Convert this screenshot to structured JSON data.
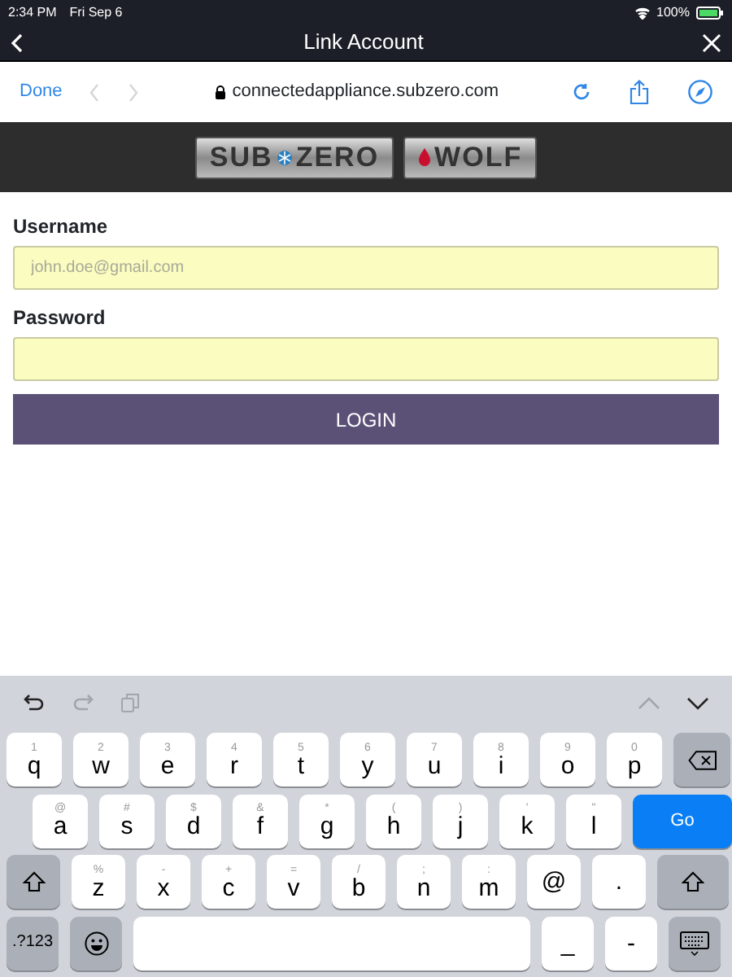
{
  "status_bar": {
    "time": "2:34 PM",
    "date": "Fri Sep 6",
    "battery": "100%"
  },
  "nav_bar": {
    "title": "Link Account"
  },
  "browser_bar": {
    "done": "Done",
    "back_disabled": true,
    "forward_disabled": true,
    "url": "connectedappliance.subzero.com"
  },
  "logos": {
    "subzero": [
      "SUB",
      "ZERO"
    ],
    "wolf": "WOLF"
  },
  "form": {
    "fields": [
      {
        "label": "Username",
        "placeholder": "john.doe@gmail.com"
      },
      {
        "label": "Password"
      }
    ],
    "button": "LOGIN"
  },
  "keyboard": {
    "toolbar": [
      {
        "kind": "undo",
        "disabled": false
      },
      {
        "kind": "redo",
        "disabled": true
      },
      {
        "kind": "paste",
        "disabled": true
      }
    ],
    "up_disabled": true,
    "down_disabled": false,
    "rows": [
      [
        {
          "kind": "letter",
          "label": "q",
          "hint": "1"
        },
        {
          "kind": "letter",
          "label": "w",
          "hint": "2"
        },
        {
          "kind": "letter",
          "label": "e",
          "hint": "3"
        },
        {
          "kind": "letter",
          "label": "r",
          "hint": "4"
        },
        {
          "kind": "letter",
          "label": "t",
          "hint": "5"
        },
        {
          "kind": "letter",
          "label": "y",
          "hint": "6"
        },
        {
          "kind": "letter",
          "label": "u",
          "hint": "7"
        },
        {
          "kind": "letter",
          "label": "i",
          "hint": "8"
        },
        {
          "kind": "letter",
          "label": "o",
          "hint": "9"
        },
        {
          "kind": "letter",
          "label": "p",
          "hint": "0"
        },
        {
          "kind": "backspace"
        }
      ],
      [
        {
          "kind": "letter",
          "label": "a",
          "hint": "@"
        },
        {
          "kind": "letter",
          "label": "s",
          "hint": "#"
        },
        {
          "kind": "letter",
          "label": "d",
          "hint": "$"
        },
        {
          "kind": "letter",
          "label": "f",
          "hint": "&"
        },
        {
          "kind": "letter",
          "label": "g",
          "hint": "*"
        },
        {
          "kind": "letter",
          "label": "h",
          "hint": "("
        },
        {
          "kind": "letter",
          "label": "j",
          "hint": ")"
        },
        {
          "kind": "letter",
          "label": "k",
          "hint": "'"
        },
        {
          "kind": "letter",
          "label": "l",
          "hint": "\""
        },
        {
          "kind": "go",
          "label": "Go"
        }
      ],
      [
        {
          "kind": "shift"
        },
        {
          "kind": "letter",
          "label": "z",
          "hint": "%"
        },
        {
          "kind": "letter",
          "label": "x",
          "hint": "-"
        },
        {
          "kind": "letter",
          "label": "c",
          "hint": "+"
        },
        {
          "kind": "letter",
          "label": "v",
          "hint": "="
        },
        {
          "kind": "letter",
          "label": "b",
          "hint": "/"
        },
        {
          "kind": "letter",
          "label": "n",
          "hint": ";"
        },
        {
          "kind": "letter",
          "label": "m",
          "hint": ":"
        },
        {
          "kind": "letter",
          "label": "@"
        },
        {
          "kind": "letter",
          "label": "."
        },
        {
          "kind": "shift"
        }
      ],
      [
        {
          "kind": "mode",
          "label": ".?123"
        },
        {
          "kind": "emoji"
        },
        {
          "kind": "space"
        },
        {
          "kind": "letter",
          "label": "_"
        },
        {
          "kind": "letter",
          "label": "-"
        },
        {
          "kind": "hide"
        }
      ]
    ]
  }
}
